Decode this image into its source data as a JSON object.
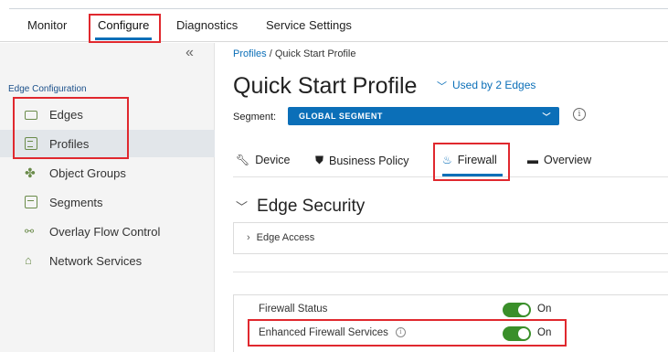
{
  "topnav": {
    "tabs": [
      {
        "label": "Monitor"
      },
      {
        "label": "Configure"
      },
      {
        "label": "Diagnostics"
      },
      {
        "label": "Service Settings"
      }
    ],
    "active": "Configure"
  },
  "sidebar": {
    "collapse_glyph": "«",
    "heading": "Edge Configuration",
    "items": [
      {
        "label": "Edges",
        "icon": "edge-device-icon"
      },
      {
        "label": "Profiles",
        "icon": "profile-icon"
      },
      {
        "label": "Object Groups",
        "icon": "object-groups-icon"
      },
      {
        "label": "Segments",
        "icon": "segments-icon"
      },
      {
        "label": "Overlay Flow Control",
        "icon": "overlay-flow-icon"
      },
      {
        "label": "Network Services",
        "icon": "network-services-icon"
      }
    ],
    "active": "Profiles"
  },
  "main": {
    "breadcrumb": {
      "parent": "Profiles",
      "separator": " / ",
      "current": "Quick Start Profile"
    },
    "title": "Quick Start Profile",
    "used_by": "Used by 2 Edges",
    "segment": {
      "label": "Segment:",
      "value": "GLOBAL SEGMENT"
    },
    "tabs": [
      {
        "label": "Device",
        "icon": "wrench-icon"
      },
      {
        "label": "Business Policy",
        "icon": "shield-icon"
      },
      {
        "label": "Firewall",
        "icon": "flame-icon"
      },
      {
        "label": "Overview",
        "icon": "overview-icon"
      }
    ],
    "active_tab": "Firewall",
    "section_title": "Edge Security",
    "edge_access": "Edge Access",
    "firewall_status": {
      "label": "Firewall Status",
      "state": "On"
    },
    "enhanced_services": {
      "label": "Enhanced Firewall Services",
      "state": "On"
    }
  },
  "colors": {
    "accent": "#0b6fb8",
    "toggle_on": "#3a8f2a",
    "highlight_box": "#e0282e",
    "icon_green": "#6a8b4a"
  }
}
